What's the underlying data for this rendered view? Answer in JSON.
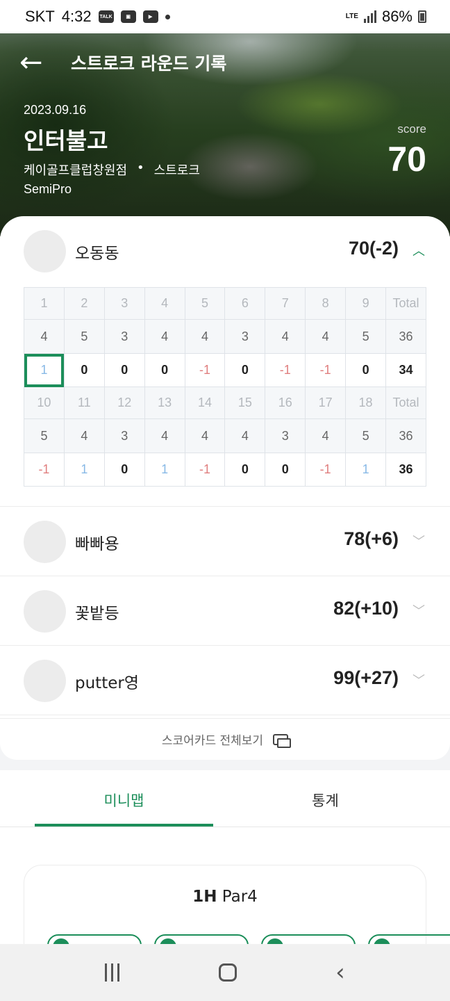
{
  "status_bar": {
    "carrier": "SKT",
    "time": "4:32",
    "talk_icon_text": "TALK",
    "lte": "LTE",
    "battery": "86%"
  },
  "header": {
    "title": "스트로크 라운드 기록",
    "back_icon": "arrow-left-icon"
  },
  "round": {
    "date": "2023.09.16",
    "course": "인터불고",
    "venue": "케이골프클럽창원점",
    "separator": "•",
    "mode": "스트로크",
    "level": "SemiPro",
    "score_label": "score",
    "score": "70"
  },
  "players": [
    {
      "name": "오동동",
      "score": "70(-2)",
      "expanded": true
    },
    {
      "name": "빠빠용",
      "score": "78(+6)",
      "expanded": false
    },
    {
      "name": "꽃밭등",
      "score": "82(+10)",
      "expanded": false
    },
    {
      "name": "putter영",
      "score": "99(+27)",
      "expanded": false
    }
  ],
  "scorecard": {
    "front": {
      "holes": [
        "1",
        "2",
        "3",
        "4",
        "5",
        "6",
        "7",
        "8",
        "9",
        "Total"
      ],
      "pars": [
        "4",
        "5",
        "3",
        "4",
        "4",
        "3",
        "4",
        "4",
        "5",
        "36"
      ],
      "scores": [
        "1",
        "0",
        "0",
        "0",
        "-1",
        "0",
        "-1",
        "-1",
        "0",
        "34"
      ]
    },
    "back": {
      "holes": [
        "10",
        "11",
        "12",
        "13",
        "14",
        "15",
        "16",
        "17",
        "18",
        "Total"
      ],
      "pars": [
        "5",
        "4",
        "3",
        "4",
        "4",
        "4",
        "3",
        "4",
        "5",
        "36"
      ],
      "scores": [
        "-1",
        "1",
        "0",
        "1",
        "-1",
        "0",
        "0",
        "-1",
        "1",
        "36"
      ]
    }
  },
  "view_all": "스코어카드 전체보기",
  "tabs": [
    {
      "label": "미니맵",
      "active": true
    },
    {
      "label": "통계",
      "active": false
    }
  ],
  "minimap": {
    "hole": "1H",
    "par": "Par4"
  },
  "colors": {
    "accent": "#1c8e5a",
    "under_par": "#e07f7f",
    "over_par": "#88b9e6"
  }
}
